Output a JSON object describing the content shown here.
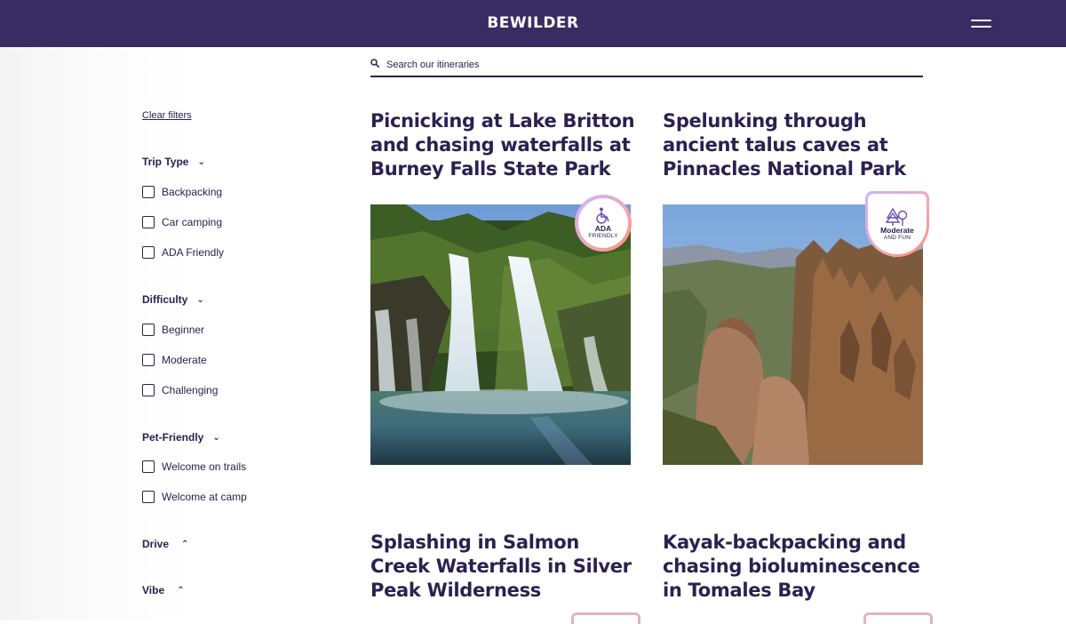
{
  "header": {
    "logo": "BEWILDER"
  },
  "search": {
    "placeholder": "Search our itineraries"
  },
  "filters": {
    "clear_label": "Clear filters",
    "groups": [
      {
        "title": "Trip Type",
        "expanded": true,
        "options": [
          "Backpacking",
          "Car camping",
          "ADA Friendly"
        ]
      },
      {
        "title": "Difficulty",
        "expanded": true,
        "options": [
          "Beginner",
          "Moderate",
          "Challenging"
        ]
      },
      {
        "title": "Pet-Friendly",
        "expanded": true,
        "options": [
          "Welcome on trails",
          "Welcome at camp"
        ]
      },
      {
        "title": "Drive",
        "expanded": false,
        "options": []
      },
      {
        "title": "Vibe",
        "expanded": false,
        "options": []
      }
    ]
  },
  "cards": [
    {
      "title": "Picnicking at Lake Britton and chasing waterfalls at Burney Falls State Park",
      "badge": {
        "main": "ADA",
        "sub": "FRIENDLY",
        "icon": "wheelchair-icon"
      }
    },
    {
      "title": "Spelunking through ancient talus caves at Pinnacles National Park",
      "badge": {
        "main": "Moderate",
        "sub": "AND FUN",
        "icon": "trees-icon"
      }
    },
    {
      "title": "Splashing in Salmon Creek Waterfalls in Silver Peak Wilderness"
    },
    {
      "title": "Kayak-backpacking and chasing bioluminescence in Tomales Bay"
    }
  ],
  "colors": {
    "header_bg": "#392c62",
    "text": "#2b2150",
    "badge_gradient": [
      "#c8b6ff",
      "#f3a6b4",
      "#ff8f6b"
    ]
  }
}
